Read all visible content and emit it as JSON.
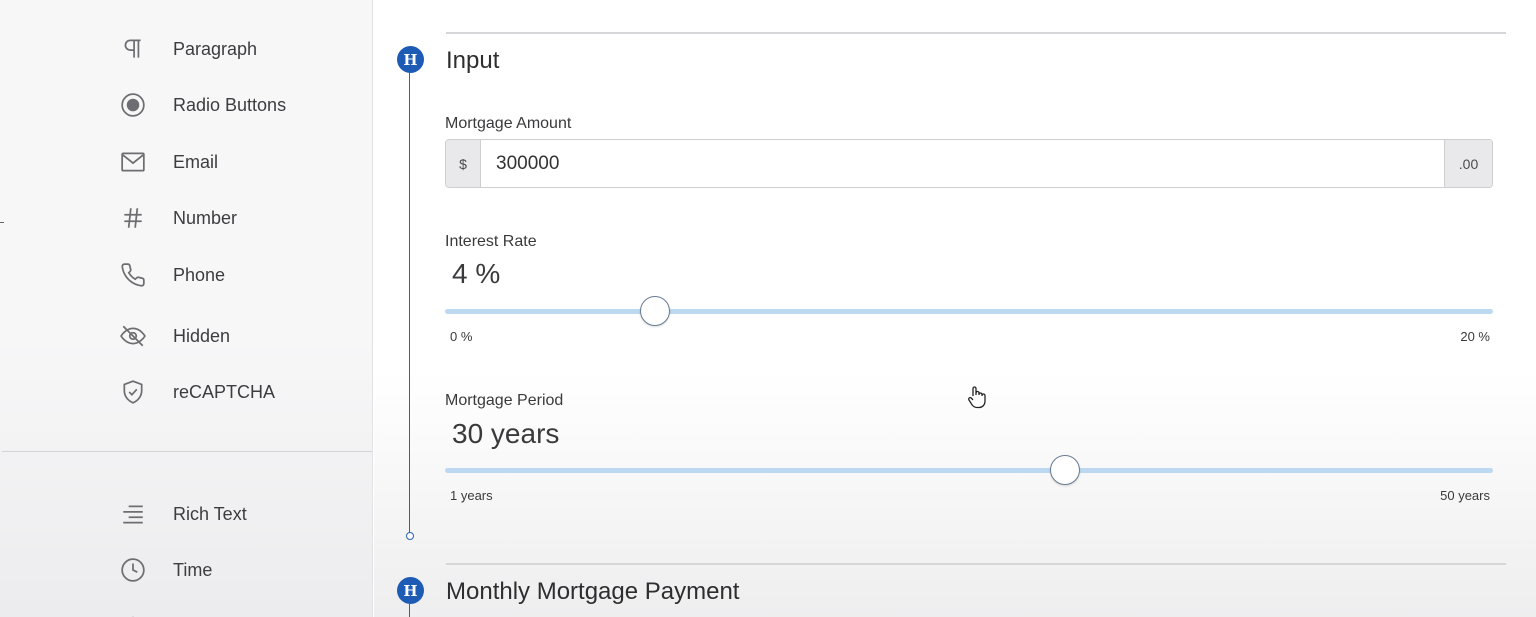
{
  "palette": {
    "items": [
      {
        "label": "Paragraph",
        "icon": "paragraph-icon"
      },
      {
        "label": "Radio Buttons",
        "icon": "radio-icon"
      },
      {
        "label": "Email",
        "icon": "envelope-icon"
      },
      {
        "label": "Number",
        "icon": "hash-icon"
      },
      {
        "label": "Phone",
        "icon": "phone-icon"
      },
      {
        "label": "Hidden",
        "icon": "eye-off-icon"
      },
      {
        "label": "reCAPTCHA",
        "icon": "shield-check-icon"
      }
    ],
    "items2": [
      {
        "label": "Rich Text",
        "icon": "align-right-icon"
      },
      {
        "label": "Time",
        "icon": "clock-icon"
      }
    ]
  },
  "sections": {
    "input": {
      "marker": "H",
      "title": "Input"
    },
    "payment": {
      "marker": "H",
      "title": "Monthly Mortgage Payment"
    }
  },
  "mortgage_amount": {
    "label": "Mortgage Amount",
    "prefix": "$",
    "value": "300000",
    "suffix": ".00"
  },
  "interest_rate": {
    "label": "Interest Rate",
    "display": "4 %",
    "value": 4,
    "min": 0,
    "max": 20,
    "min_label": "0 %",
    "max_label": "20 %"
  },
  "mortgage_period": {
    "label": "Mortgage Period",
    "display": "30 years",
    "value": 30,
    "min": 1,
    "max": 50,
    "min_label": "1 years",
    "max_label": "50 years"
  },
  "colors": {
    "accent": "#1e5bb5",
    "slider_track": "#bcd9f1"
  }
}
